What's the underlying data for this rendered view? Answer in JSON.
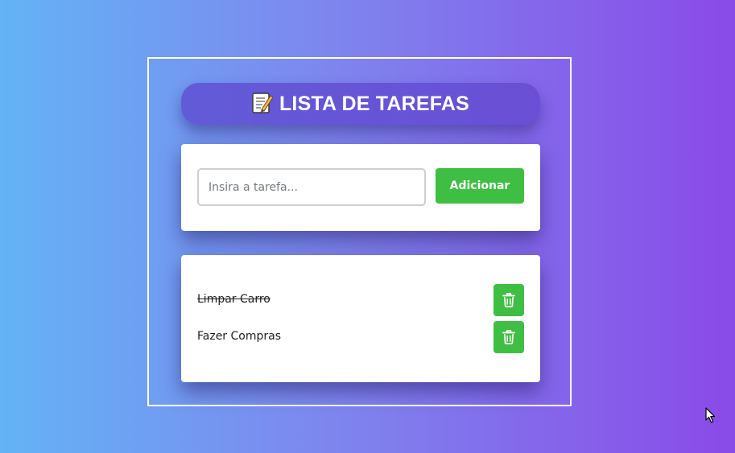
{
  "header": {
    "title": "LISTA DE TAREFAS",
    "icon": "memo-icon"
  },
  "form": {
    "input_value": "",
    "input_placeholder": "Insira a tarefa...",
    "add_label": "Adicionar"
  },
  "tasks": [
    {
      "text": "Limpar Carro",
      "completed": true
    },
    {
      "text": "Fazer Compras",
      "completed": false
    }
  ],
  "colors": {
    "accent_green": "#3fbe44",
    "title_purple": "#625bd7",
    "background_start": "#63b3f6",
    "background_end": "#8a4ae8"
  }
}
